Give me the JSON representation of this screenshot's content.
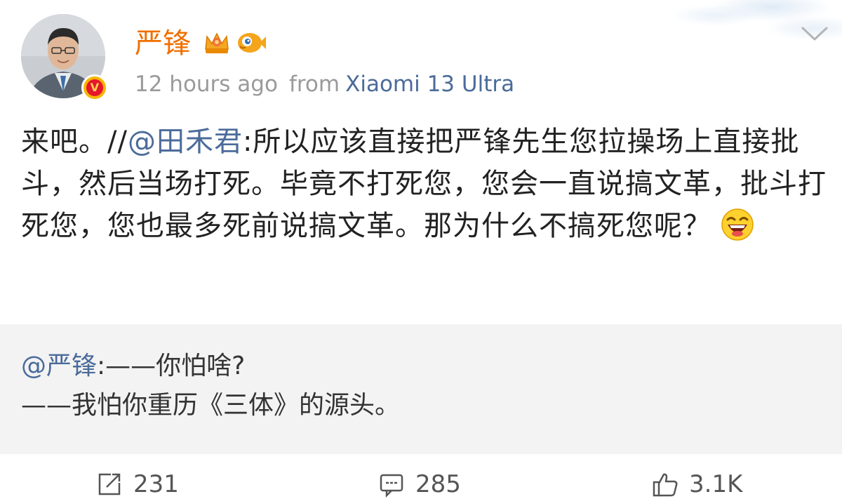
{
  "post": {
    "author": "严锋",
    "time": "12 hours ago",
    "from_label": "from",
    "device": "Xiaomi 13 Ultra",
    "text_part1": "来吧。//",
    "mention1": "@田禾君",
    "text_part2": ":所以应该直接把严锋先生您拉操场上直接批斗，然后当场打死。毕竟不打死您，您会一直说搞文革，批斗打死您，您也最多死前说搞文革。那为什么不搞死您呢？"
  },
  "repost": {
    "mention": "@严锋",
    "line1_rest": ":——你怕啥?",
    "line2": "——我怕你重历《三体》的源头。"
  },
  "actions": {
    "repost_count": "231",
    "comment_count": "285",
    "like_count": "3.1K"
  },
  "colors": {
    "username": "#f06f00",
    "link": "#4b6b9a",
    "meta_gray": "#9a9a9a",
    "repost_bg": "#f3f3f3"
  },
  "icons": {
    "crown": "crown-icon",
    "fish": "fish-icon",
    "verified": "verified-badge-icon",
    "menu": "chevron-down-icon",
    "emoji": "laugh-emoji-icon",
    "repost": "repost-icon",
    "comment": "comment-icon",
    "like": "thumbs-up-icon"
  }
}
